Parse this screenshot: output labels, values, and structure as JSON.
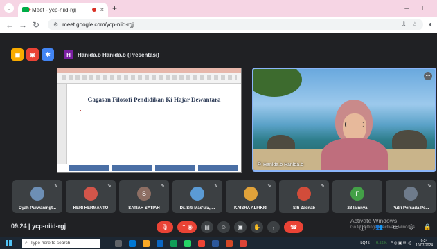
{
  "browser": {
    "tab_title": "Meet - ycp-niid-rgj",
    "tab_close": "×",
    "new_tab": "+",
    "url": "meet.google.com/ycp-niid-rgj",
    "minimize": "–",
    "maximize": "□"
  },
  "presentation": {
    "presenter_initial": "H",
    "presenter_label": "Hanida.b Hanida.b (Presentasi)",
    "slide_title": "Gagasan Filosofi Pendidikan Ki Hajar Dewantara"
  },
  "video": {
    "name": "Hanida.b Hanida.b"
  },
  "participants": [
    {
      "name": "Dyah Purwaningt...",
      "initial": "",
      "color": "#6d8fb5"
    },
    {
      "name": "HERI HERMANTO",
      "initial": "",
      "color": "#d2554a"
    },
    {
      "name": "SATIAH SATIAH",
      "initial": "S",
      "color": "#8d6e63"
    },
    {
      "name": "Dr. Siti Mas'ula, ...",
      "initial": "",
      "color": "#5b9bd5"
    },
    {
      "name": "KAISRA ALFIKRI",
      "initial": "",
      "color": "#e0a23a"
    },
    {
      "name": "Siti Zaenab",
      "initial": "",
      "color": "#d24c3a"
    },
    {
      "name": "28 lainnya",
      "initial": "F",
      "color": "#43a047"
    },
    {
      "name": "Putri Persada Pe...",
      "initial": "",
      "color": "#6e7b8b"
    }
  ],
  "meeting": {
    "time": "09.24",
    "separator": "|",
    "code": "ycp-niid-rgj"
  },
  "watermark": {
    "line1": "Activate Windows",
    "line2": "Go to Settings to activate Windows."
  },
  "taskbar": {
    "search_placeholder": "Type here to search",
    "network_label": "LQ45",
    "network_change": "+0.56%",
    "time": "9:24",
    "date": "10/07/2024"
  },
  "colors": {
    "meet_bg": "#202124",
    "tile_bg": "#3c4043",
    "end_call": "#ea4335",
    "accent": "#8ab4f8"
  }
}
